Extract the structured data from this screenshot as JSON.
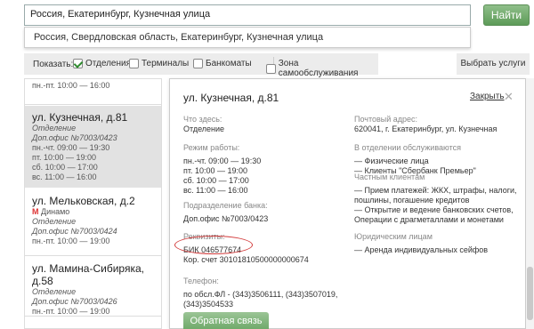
{
  "search": {
    "value": "Россия, Екатеринбург, Кузнечная улица",
    "button": "Найти"
  },
  "suggestion": "Россия, Свердловская область, Екатеринбург, Кузнечная улица",
  "filters": {
    "label": "Показать:",
    "items": [
      {
        "label": "Отделения",
        "checked": true
      },
      {
        "label": "Терминалы",
        "checked": false
      },
      {
        "label": "Банкоматы",
        "checked": false
      },
      {
        "label": "Зона самообслуживания",
        "checked": false
      }
    ]
  },
  "services_button": "Выбрать услуги",
  "branches": [
    {
      "title": "",
      "lines": [
        "пн.-пт. 10:00 — 16:00"
      ]
    },
    {
      "title": "ул. Кузнечная, д.81",
      "office": "Отделение",
      "office2": "Доп.офис №7003/0423",
      "hours": [
        "пн.-чт. 09:00 — 19:30",
        "пт. 10:00 — 19:00",
        "сб. 10:00 — 17:00",
        "вс. 11:00 — 16:00"
      ]
    },
    {
      "title": "ул. Мельковская, д.2",
      "metro": "Динамо",
      "office": "Отделение",
      "office2": "Доп.офис №7003/0424",
      "hours": [
        "пн.-пт. 10:00 — 19:00"
      ]
    },
    {
      "title": "ул. Мамина-Сибиряка, д.58",
      "office": "Отделение",
      "office2": "Доп.офис №7003/0426",
      "hours": [
        "пн.-пт. 10:00 — 19:00"
      ]
    }
  ],
  "detail": {
    "title": "ул. Кузнечная, д.81",
    "close": "Закрыть",
    "what_h": "Что здесь:",
    "what": "Отделение",
    "mode_h": "Режим работы:",
    "mode": [
      "пн.-чт. 09:00 — 19:30",
      "пт. 10:00 — 19:00",
      "сб. 10:00 — 17:00",
      "вс. 11:00 — 16:00"
    ],
    "sub_h": "Подразделение банка:",
    "sub": "Доп.офис №7003/0423",
    "req_h": "Реквизиты:",
    "bik": "БИК 046577674",
    "acct": "Кор. счет 30101810500000000674",
    "phone_h": "Телефон:",
    "phone": [
      "по обсл.ФЛ - (343)3506111, (343)3507019,",
      "(343)3504533"
    ],
    "addr_h": "Почтовый адрес:",
    "addr": "620041, г. Екатеринбург, ул. Кузнечная",
    "served_h": "В отделении обслуживаются",
    "served": [
      "— Физические лица",
      "— Клиенты \"Сбербанк Премьер\""
    ],
    "private_h": "Частным клиентам",
    "private": [
      "— Прием платежей: ЖКХ, штрафы, налоги,",
      "пошлины, погашение кредитов",
      "— Открытие и ведение банковских счетов,",
      "Операции с драгметаллами и монетами"
    ],
    "legal_h": "Юридическим лицам",
    "legal": [
      "— Аренда индивидуальных сейфов"
    ],
    "feedback": "Обратная связь"
  }
}
